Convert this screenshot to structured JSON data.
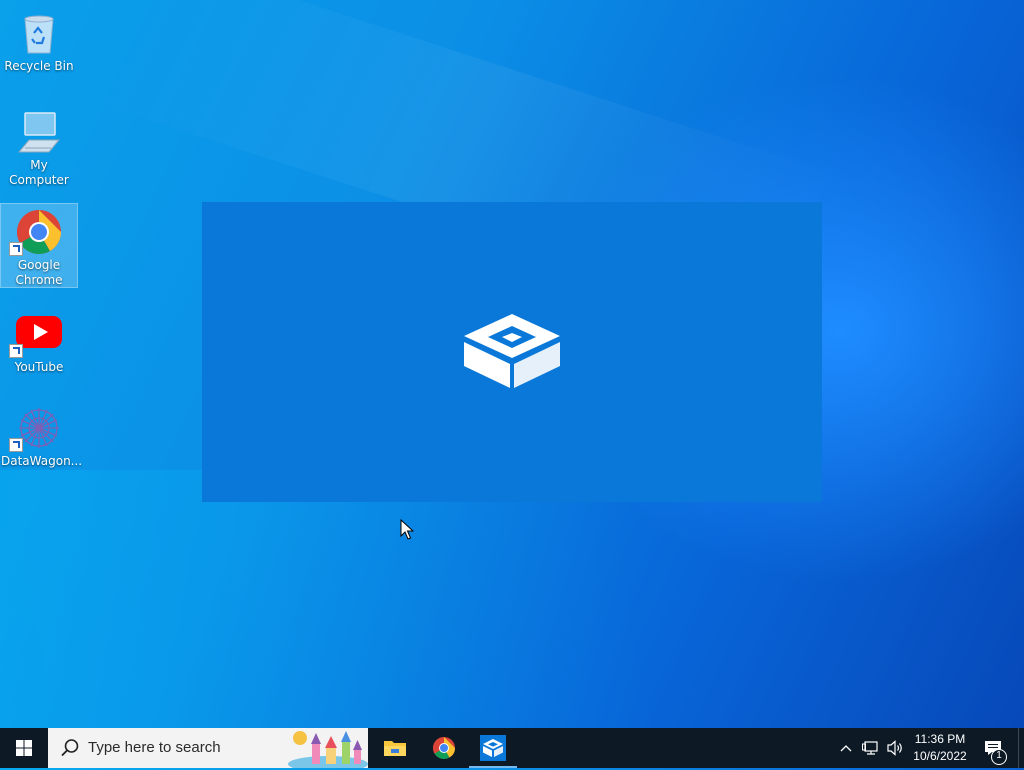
{
  "desktop": {
    "icons": [
      {
        "label": "Recycle Bin",
        "icon": "recycle-bin-icon"
      },
      {
        "label": "My Computer",
        "icon": "computer-icon"
      },
      {
        "label": "Google Chrome",
        "icon": "chrome-icon",
        "selected": true
      },
      {
        "label": "YouTube",
        "icon": "youtube-icon"
      },
      {
        "label": "DataWagon...",
        "icon": "datawagon-icon"
      }
    ]
  },
  "splash": {
    "icon": "sandbox-icon",
    "color": "#0a78d8"
  },
  "taskbar": {
    "start_icon": "windows-logo-icon",
    "search": {
      "placeholder": "Type here to search"
    },
    "pinned": [
      {
        "icon": "file-explorer-icon"
      },
      {
        "icon": "chrome-icon"
      },
      {
        "icon": "sandbox-icon",
        "active": true
      }
    ],
    "tray": {
      "icons": [
        "chevron-up-icon",
        "network-icon",
        "volume-icon"
      ],
      "time": "11:36 PM",
      "date": "10/6/2022",
      "notification_count": "1"
    }
  },
  "colors": {
    "taskbar": "#0d1a26",
    "accent": "#0a78d8",
    "desktop": "#0b8fe6"
  }
}
